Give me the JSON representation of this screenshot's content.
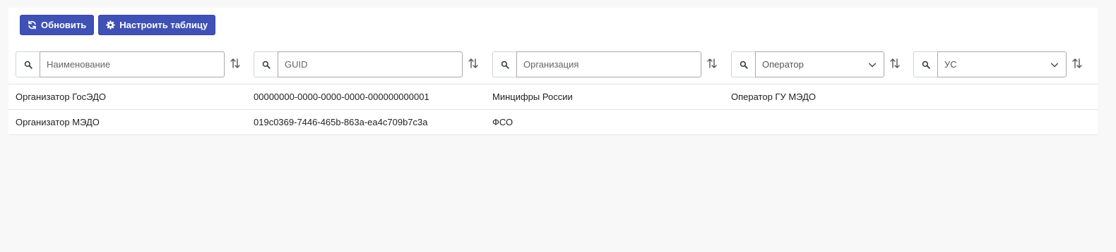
{
  "toolbar": {
    "refresh_label": "Обновить",
    "configure_label": "Настроить таблицу",
    "button_color": "#3f51b5"
  },
  "filters": [
    {
      "type": "text",
      "placeholder": "Наименование",
      "icon": "search-icon",
      "sort_icon": "sort-icon"
    },
    {
      "type": "text",
      "placeholder": "GUID",
      "icon": "search-icon",
      "sort_icon": "sort-icon"
    },
    {
      "type": "text",
      "placeholder": "Организация",
      "icon": "search-icon",
      "sort_icon": "sort-icon"
    },
    {
      "type": "select",
      "value": "Оператор",
      "icon": "search-icon",
      "sort_icon": "sort-icon"
    },
    {
      "type": "select",
      "value": "УС",
      "icon": "search-icon",
      "sort_icon": "sort-icon"
    }
  ],
  "rows": [
    {
      "name": "Организатор ГосЭДО",
      "guid": "00000000-0000-0000-0000-000000000001",
      "organization": "Минцифры России",
      "operator": "Оператор ГУ МЭДО",
      "us": ""
    },
    {
      "name": "Организатор МЭДО",
      "guid": "019c0369-7446-465b-863a-ea4c709b7c3a",
      "organization": "ФСО",
      "operator": "",
      "us": ""
    }
  ]
}
